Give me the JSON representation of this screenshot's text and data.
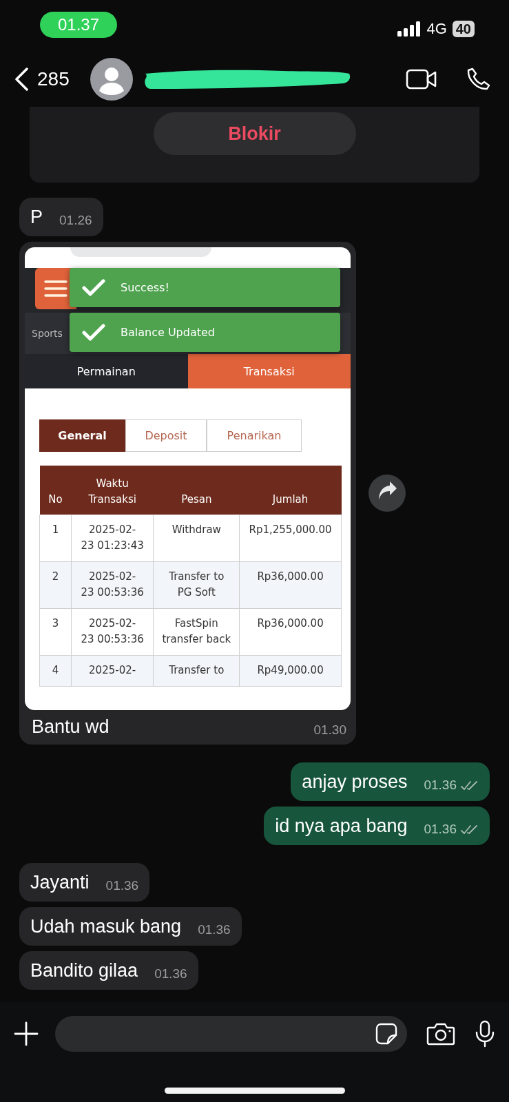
{
  "status_bar": {
    "time": "01.37",
    "network": "4G",
    "battery": "40"
  },
  "header": {
    "back_count": "285"
  },
  "banner": {
    "button": "Blokir"
  },
  "messages": [
    {
      "kind": "incoming",
      "text": "P",
      "time": "01.26"
    },
    {
      "kind": "image",
      "caption": "Bantu wd",
      "time": "01.30",
      "screenshot": {
        "toasts": [
          "Success!",
          "Balance Updated"
        ],
        "nav_label": "Sports",
        "tabs": [
          {
            "label": "Permainan",
            "selected": false
          },
          {
            "label": "Transaksi",
            "selected": true
          }
        ],
        "subtabs": [
          {
            "label": "General",
            "selected": true
          },
          {
            "label": "Deposit",
            "selected": false
          },
          {
            "label": "Penarikan",
            "selected": false
          }
        ],
        "table": {
          "columns": [
            "No",
            "Waktu Transaksi",
            "Pesan",
            "Jumlah"
          ],
          "rows": [
            [
              "1",
              "2025-02-23 01:23:43",
              "Withdraw",
              "Rp1,255,000.00"
            ],
            [
              "2",
              "2025-02-23 00:53:36",
              "Transfer to PG Soft",
              "Rp36,000.00"
            ],
            [
              "3",
              "2025-02-23 00:53:36",
              "FastSpin transfer back",
              "Rp36,000.00"
            ],
            [
              "4",
              "2025-02-",
              "Transfer to",
              "Rp49,000.00"
            ]
          ]
        }
      }
    },
    {
      "kind": "outgoing",
      "text": "anjay proses",
      "time": "01.36"
    },
    {
      "kind": "outgoing",
      "text": "id nya apa bang",
      "time": "01.36"
    },
    {
      "kind": "incoming",
      "text": "Jayanti",
      "time": "01.36"
    },
    {
      "kind": "incoming",
      "text": "Udah masuk bang",
      "time": "01.36"
    },
    {
      "kind": "incoming",
      "text": "Bandito gilaa",
      "time": "01.36"
    }
  ]
}
